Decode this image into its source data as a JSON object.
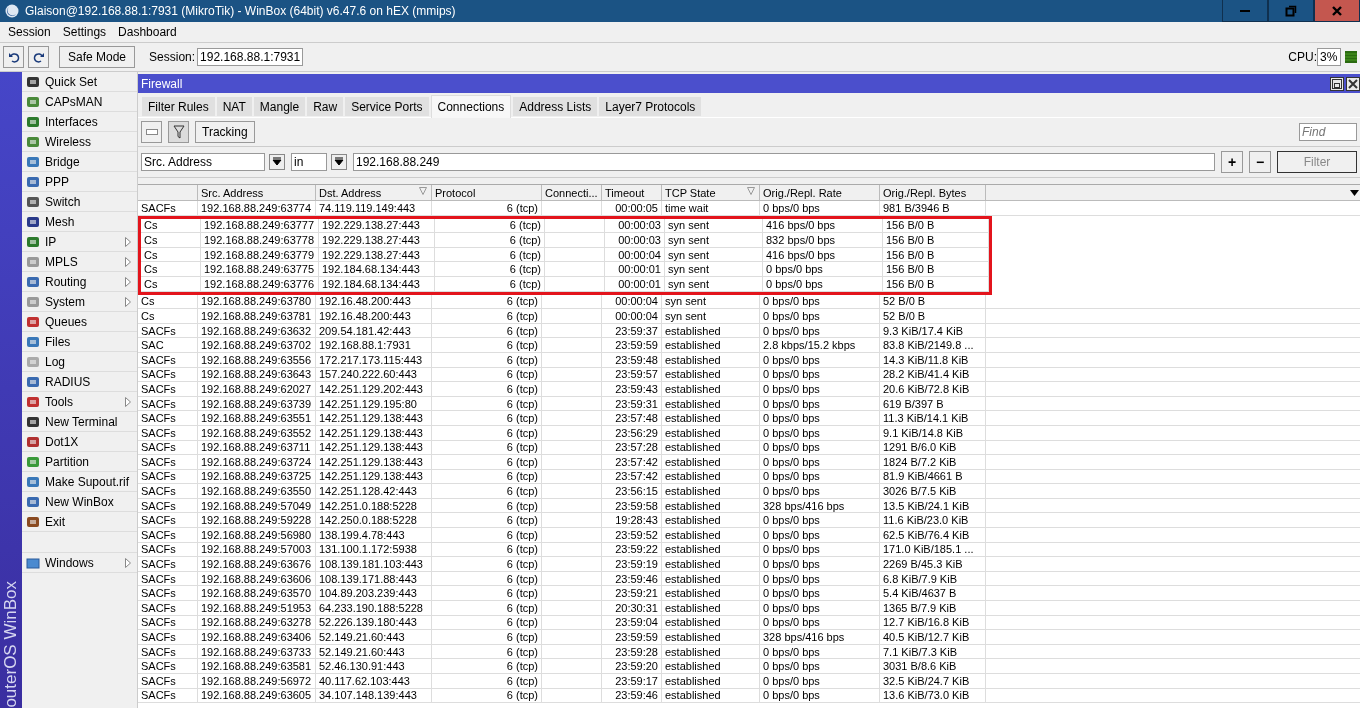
{
  "window": {
    "title": "Glaison@192.168.88.1:7931 (MikroTik) - WinBox (64bit) v6.47.6 on hEX (mmips)"
  },
  "menu": [
    "Session",
    "Settings",
    "Dashboard"
  ],
  "toolbar": {
    "safe_mode": "Safe Mode",
    "session_label": "Session:",
    "session": "192.168.88.1:7931",
    "cpu_label": "CPU:",
    "cpu": "3%"
  },
  "side_label": "outerOS WinBox",
  "sidebar": {
    "items": [
      {
        "label": "Quick Set",
        "submenu": false
      },
      {
        "label": "CAPsMAN",
        "submenu": false
      },
      {
        "label": "Interfaces",
        "submenu": false
      },
      {
        "label": "Wireless",
        "submenu": false
      },
      {
        "label": "Bridge",
        "submenu": false
      },
      {
        "label": "PPP",
        "submenu": false
      },
      {
        "label": "Switch",
        "submenu": false
      },
      {
        "label": "Mesh",
        "submenu": false
      },
      {
        "label": "IP",
        "submenu": true
      },
      {
        "label": "MPLS",
        "submenu": true
      },
      {
        "label": "Routing",
        "submenu": true
      },
      {
        "label": "System",
        "submenu": true
      },
      {
        "label": "Queues",
        "submenu": false
      },
      {
        "label": "Files",
        "submenu": false
      },
      {
        "label": "Log",
        "submenu": false
      },
      {
        "label": "RADIUS",
        "submenu": false
      },
      {
        "label": "Tools",
        "submenu": true
      },
      {
        "label": "New Terminal",
        "submenu": false
      },
      {
        "label": "Dot1X",
        "submenu": false
      },
      {
        "label": "Partition",
        "submenu": false
      },
      {
        "label": "Make Supout.rif",
        "submenu": false
      },
      {
        "label": "New WinBox",
        "submenu": false
      },
      {
        "label": "Exit",
        "submenu": false
      }
    ],
    "bottom_items": [
      {
        "label": "Windows",
        "submenu": true
      }
    ]
  },
  "panel": {
    "title": "Firewall",
    "tabs": [
      {
        "label": "Filter Rules",
        "selected": false
      },
      {
        "label": "NAT",
        "selected": false
      },
      {
        "label": "Mangle",
        "selected": false
      },
      {
        "label": "Raw",
        "selected": false
      },
      {
        "label": "Service Ports",
        "selected": false
      },
      {
        "label": "Connections",
        "selected": true
      },
      {
        "label": "Address Lists",
        "selected": false
      },
      {
        "label": "Layer7 Protocols",
        "selected": false
      }
    ],
    "tracking": "Tracking",
    "find": {
      "placeholder": "Find"
    },
    "filter": {
      "field": "Src. Address",
      "operator": "in",
      "value": "192.168.88.249",
      "add": "+",
      "remove": "−",
      "apply": "Filter",
      "apply_disabled": true
    },
    "columns": [
      {
        "label": "Src. Address",
        "sorted": false
      },
      {
        "label": "Dst. Address",
        "sorted": true
      },
      {
        "label": "Protocol",
        "sorted": false
      },
      {
        "label": "Connecti...",
        "sorted": false
      },
      {
        "label": "Timeout",
        "sorted": false
      },
      {
        "label": "TCP State",
        "sorted": true
      },
      {
        "label": "Orig./Repl. Rate",
        "sorted": false
      },
      {
        "label": "Orig./Repl. Bytes",
        "sorted": false
      }
    ],
    "rows": [
      {
        "flags": "SACFs",
        "src": "192.168.88.249:63774",
        "dst": "74.119.119.149:443",
        "protocol": "6 (tcp)",
        "timeout": "00:00:05",
        "tcp_state": "time wait",
        "rate": "0 bps/0 bps",
        "bytes": "981 B/3946 B",
        "highlighted": false
      },
      {
        "flags": "Cs",
        "src": "192.168.88.249:63777",
        "dst": "192.229.138.27:443",
        "protocol": "6 (tcp)",
        "timeout": "00:00:03",
        "tcp_state": "syn sent",
        "rate": "416 bps/0 bps",
        "bytes": "156 B/0 B",
        "highlighted": true
      },
      {
        "flags": "Cs",
        "src": "192.168.88.249:63778",
        "dst": "192.229.138.27:443",
        "protocol": "6 (tcp)",
        "timeout": "00:00:03",
        "tcp_state": "syn sent",
        "rate": "832 bps/0 bps",
        "bytes": "156 B/0 B",
        "highlighted": true
      },
      {
        "flags": "Cs",
        "src": "192.168.88.249:63779",
        "dst": "192.229.138.27:443",
        "protocol": "6 (tcp)",
        "timeout": "00:00:04",
        "tcp_state": "syn sent",
        "rate": "416 bps/0 bps",
        "bytes": "156 B/0 B",
        "highlighted": true
      },
      {
        "flags": "Cs",
        "src": "192.168.88.249:63775",
        "dst": "192.184.68.134:443",
        "protocol": "6 (tcp)",
        "timeout": "00:00:01",
        "tcp_state": "syn sent",
        "rate": "0 bps/0 bps",
        "bytes": "156 B/0 B",
        "highlighted": true
      },
      {
        "flags": "Cs",
        "src": "192.168.88.249:63776",
        "dst": "192.184.68.134:443",
        "protocol": "6 (tcp)",
        "timeout": "00:00:01",
        "tcp_state": "syn sent",
        "rate": "0 bps/0 bps",
        "bytes": "156 B/0 B",
        "highlighted": true
      },
      {
        "flags": "Cs",
        "src": "192.168.88.249:63780",
        "dst": "192.16.48.200:443",
        "protocol": "6 (tcp)",
        "timeout": "00:00:04",
        "tcp_state": "syn sent",
        "rate": "0 bps/0 bps",
        "bytes": "52 B/0 B",
        "highlighted": false
      },
      {
        "flags": "Cs",
        "src": "192.168.88.249:63781",
        "dst": "192.16.48.200:443",
        "protocol": "6 (tcp)",
        "timeout": "00:00:04",
        "tcp_state": "syn sent",
        "rate": "0 bps/0 bps",
        "bytes": "52 B/0 B",
        "highlighted": false
      },
      {
        "flags": "SACFs",
        "src": "192.168.88.249:63632",
        "dst": "209.54.181.42:443",
        "protocol": "6 (tcp)",
        "timeout": "23:59:37",
        "tcp_state": "established",
        "rate": "0 bps/0 bps",
        "bytes": "9.3 KiB/17.4 KiB",
        "highlighted": false
      },
      {
        "flags": "SAC",
        "src": "192.168.88.249:63702",
        "dst": "192.168.88.1:7931",
        "protocol": "6 (tcp)",
        "timeout": "23:59:59",
        "tcp_state": "established",
        "rate": "2.8 kbps/15.2 kbps",
        "bytes": "83.8 KiB/2149.8 ...",
        "highlighted": false
      },
      {
        "flags": "SACFs",
        "src": "192.168.88.249:63556",
        "dst": "172.217.173.115:443",
        "protocol": "6 (tcp)",
        "timeout": "23:59:48",
        "tcp_state": "established",
        "rate": "0 bps/0 bps",
        "bytes": "14.3 KiB/11.8 KiB",
        "highlighted": false
      },
      {
        "flags": "SACFs",
        "src": "192.168.88.249:63643",
        "dst": "157.240.222.60:443",
        "protocol": "6 (tcp)",
        "timeout": "23:59:57",
        "tcp_state": "established",
        "rate": "0 bps/0 bps",
        "bytes": "28.2 KiB/41.4 KiB",
        "highlighted": false
      },
      {
        "flags": "SACFs",
        "src": "192.168.88.249:62027",
        "dst": "142.251.129.202:443",
        "protocol": "6 (tcp)",
        "timeout": "23:59:43",
        "tcp_state": "established",
        "rate": "0 bps/0 bps",
        "bytes": "20.6 KiB/72.8 KiB",
        "highlighted": false
      },
      {
        "flags": "SACFs",
        "src": "192.168.88.249:63739",
        "dst": "142.251.129.195:80",
        "protocol": "6 (tcp)",
        "timeout": "23:59:31",
        "tcp_state": "established",
        "rate": "0 bps/0 bps",
        "bytes": "619 B/397 B",
        "highlighted": false
      },
      {
        "flags": "SACFs",
        "src": "192.168.88.249:63551",
        "dst": "142.251.129.138:443",
        "protocol": "6 (tcp)",
        "timeout": "23:57:48",
        "tcp_state": "established",
        "rate": "0 bps/0 bps",
        "bytes": "11.3 KiB/14.1 KiB",
        "highlighted": false
      },
      {
        "flags": "SACFs",
        "src": "192.168.88.249:63552",
        "dst": "142.251.129.138:443",
        "protocol": "6 (tcp)",
        "timeout": "23:56:29",
        "tcp_state": "established",
        "rate": "0 bps/0 bps",
        "bytes": "9.1 KiB/14.8 KiB",
        "highlighted": false
      },
      {
        "flags": "SACFs",
        "src": "192.168.88.249:63711",
        "dst": "142.251.129.138:443",
        "protocol": "6 (tcp)",
        "timeout": "23:57:28",
        "tcp_state": "established",
        "rate": "0 bps/0 bps",
        "bytes": "1291 B/6.0 KiB",
        "highlighted": false
      },
      {
        "flags": "SACFs",
        "src": "192.168.88.249:63724",
        "dst": "142.251.129.138:443",
        "protocol": "6 (tcp)",
        "timeout": "23:57:42",
        "tcp_state": "established",
        "rate": "0 bps/0 bps",
        "bytes": "1824 B/7.2 KiB",
        "highlighted": false
      },
      {
        "flags": "SACFs",
        "src": "192.168.88.249:63725",
        "dst": "142.251.129.138:443",
        "protocol": "6 (tcp)",
        "timeout": "23:57:42",
        "tcp_state": "established",
        "rate": "0 bps/0 bps",
        "bytes": "81.9 KiB/4661 B",
        "highlighted": false
      },
      {
        "flags": "SACFs",
        "src": "192.168.88.249:63550",
        "dst": "142.251.128.42:443",
        "protocol": "6 (tcp)",
        "timeout": "23:56:15",
        "tcp_state": "established",
        "rate": "0 bps/0 bps",
        "bytes": "3026 B/7.5 KiB",
        "highlighted": false
      },
      {
        "flags": "SACFs",
        "src": "192.168.88.249:57049",
        "dst": "142.251.0.188:5228",
        "protocol": "6 (tcp)",
        "timeout": "23:59:58",
        "tcp_state": "established",
        "rate": "328 bps/416 bps",
        "bytes": "13.5 KiB/24.1 KiB",
        "highlighted": false
      },
      {
        "flags": "SACFs",
        "src": "192.168.88.249:59228",
        "dst": "142.250.0.188:5228",
        "protocol": "6 (tcp)",
        "timeout": "19:28:43",
        "tcp_state": "established",
        "rate": "0 bps/0 bps",
        "bytes": "11.6 KiB/23.0 KiB",
        "highlighted": false
      },
      {
        "flags": "SACFs",
        "src": "192.168.88.249:56980",
        "dst": "138.199.4.78:443",
        "protocol": "6 (tcp)",
        "timeout": "23:59:52",
        "tcp_state": "established",
        "rate": "0 bps/0 bps",
        "bytes": "62.5 KiB/76.4 KiB",
        "highlighted": false
      },
      {
        "flags": "SACFs",
        "src": "192.168.88.249:57003",
        "dst": "131.100.1.172:5938",
        "protocol": "6 (tcp)",
        "timeout": "23:59:22",
        "tcp_state": "established",
        "rate": "0 bps/0 bps",
        "bytes": "171.0 KiB/185.1 ...",
        "highlighted": false
      },
      {
        "flags": "SACFs",
        "src": "192.168.88.249:63676",
        "dst": "108.139.181.103:443",
        "protocol": "6 (tcp)",
        "timeout": "23:59:19",
        "tcp_state": "established",
        "rate": "0 bps/0 bps",
        "bytes": "2269 B/45.3 KiB",
        "highlighted": false
      },
      {
        "flags": "SACFs",
        "src": "192.168.88.249:63606",
        "dst": "108.139.171.88:443",
        "protocol": "6 (tcp)",
        "timeout": "23:59:46",
        "tcp_state": "established",
        "rate": "0 bps/0 bps",
        "bytes": "6.8 KiB/7.9 KiB",
        "highlighted": false
      },
      {
        "flags": "SACFs",
        "src": "192.168.88.249:63570",
        "dst": "104.89.203.239:443",
        "protocol": "6 (tcp)",
        "timeout": "23:59:21",
        "tcp_state": "established",
        "rate": "0 bps/0 bps",
        "bytes": "5.4 KiB/4637 B",
        "highlighted": false
      },
      {
        "flags": "SACFs",
        "src": "192.168.88.249:51953",
        "dst": "64.233.190.188:5228",
        "protocol": "6 (tcp)",
        "timeout": "20:30:31",
        "tcp_state": "established",
        "rate": "0 bps/0 bps",
        "bytes": "1365 B/7.9 KiB",
        "highlighted": false
      },
      {
        "flags": "SACFs",
        "src": "192.168.88.249:63278",
        "dst": "52.226.139.180:443",
        "protocol": "6 (tcp)",
        "timeout": "23:59:04",
        "tcp_state": "established",
        "rate": "0 bps/0 bps",
        "bytes": "12.7 KiB/16.8 KiB",
        "highlighted": false
      },
      {
        "flags": "SACFs",
        "src": "192.168.88.249:63406",
        "dst": "52.149.21.60:443",
        "protocol": "6 (tcp)",
        "timeout": "23:59:59",
        "tcp_state": "established",
        "rate": "328 bps/416 bps",
        "bytes": "40.5 KiB/12.7 KiB",
        "highlighted": false
      },
      {
        "flags": "SACFs",
        "src": "192.168.88.249:63733",
        "dst": "52.149.21.60:443",
        "protocol": "6 (tcp)",
        "timeout": "23:59:28",
        "tcp_state": "established",
        "rate": "0 bps/0 bps",
        "bytes": "7.1 KiB/7.3 KiB",
        "highlighted": false
      },
      {
        "flags": "SACFs",
        "src": "192.168.88.249:63581",
        "dst": "52.46.130.91:443",
        "protocol": "6 (tcp)",
        "timeout": "23:59:20",
        "tcp_state": "established",
        "rate": "0 bps/0 bps",
        "bytes": "3031 B/8.6 KiB",
        "highlighted": false
      },
      {
        "flags": "SACFs",
        "src": "192.168.88.249:56972",
        "dst": "40.117.62.103:443",
        "protocol": "6 (tcp)",
        "timeout": "23:59:17",
        "tcp_state": "established",
        "rate": "0 bps/0 bps",
        "bytes": "32.5 KiB/24.7 KiB",
        "highlighted": false
      },
      {
        "flags": "SACFs",
        "src": "192.168.88.249:63605",
        "dst": "34.107.148.139:443",
        "protocol": "6 (tcp)",
        "timeout": "23:59:46",
        "tcp_state": "established",
        "rate": "0 bps/0 bps",
        "bytes": "13.6 KiB/73.0 KiB",
        "highlighted": false
      }
    ]
  }
}
